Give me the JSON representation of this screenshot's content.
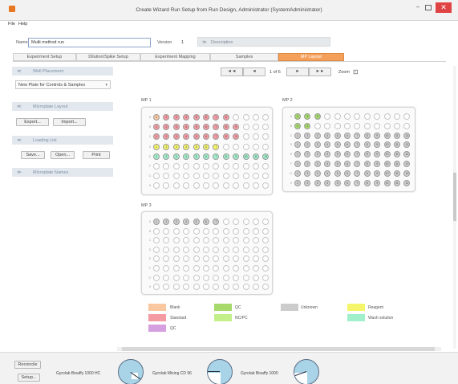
{
  "window": {
    "title": "Create Wizard Run Setup from Run Design, Administrator (SystemAdministrator)",
    "min": "–",
    "close": "✕"
  },
  "menu": [
    "File",
    "Help"
  ],
  "header": {
    "name_label": "Name",
    "name_value": "Multi method run",
    "version_label": "Version",
    "version_value": "1",
    "desc_toggle": "≫",
    "desc_label": "Description"
  },
  "tabs": [
    {
      "label": "Experiment Setup",
      "active": false
    },
    {
      "label": "Dilution/Spike Setup",
      "active": false
    },
    {
      "label": "Experiment Mapping",
      "active": false
    },
    {
      "label": "Samples",
      "active": false
    },
    {
      "label": "MP Layout",
      "active": true
    }
  ],
  "left": {
    "well_placement": {
      "chev": "≪",
      "title": "Well Placement",
      "dropdown": "New Plate for Controls & Samples",
      "arrow": "▾"
    },
    "microplate_layout": {
      "chev": "≪",
      "title": "Microplate Layout",
      "export": "Export...",
      "import": "Import..."
    },
    "loading_list": {
      "chev": "≪",
      "title": "Loading List",
      "save": "Save...",
      "open": "Open...",
      "print": "Print"
    },
    "microplate_names": {
      "chev": "≫",
      "title": "Microplate Names"
    }
  },
  "pager": {
    "first": "◄◄",
    "prev": "◄",
    "page": "1 of 6",
    "next": "►",
    "last": "►►",
    "zoom_label": "Zoom",
    "zoom_glyph": "⊡"
  },
  "plates": [
    {
      "title": "MP 1"
    },
    {
      "title": "MP 2"
    },
    {
      "title": "MP 3"
    }
  ],
  "legend": [
    {
      "label": "Blank",
      "color": "#f9c8a0"
    },
    {
      "label": "Standard",
      "color": "#f49aa2"
    },
    {
      "label": "QC",
      "color": "#d6a0e0"
    },
    {
      "label": "QC",
      "color": "#a6d96a"
    },
    {
      "label": "NC/PC",
      "color": "#c3f08a"
    },
    {
      "label": "Unknown",
      "color": "#cccccc"
    },
    {
      "label": "Reagent",
      "color": "#f5f56a"
    },
    {
      "label": "Wash solution",
      "color": "#a0f0cc"
    }
  ],
  "status": {
    "reconcile": "Reconcile",
    "setup": "Setup...",
    "instruments": [
      {
        "label": "Gyrolab Bioaffy 1000 HC",
        "fill": 0.85
      },
      {
        "label": "Gyrolab Mixing CD 96",
        "fill": 0.3
      },
      {
        "label": "Gyrolab Bioaffy 1000",
        "fill": 0.2
      }
    ]
  }
}
